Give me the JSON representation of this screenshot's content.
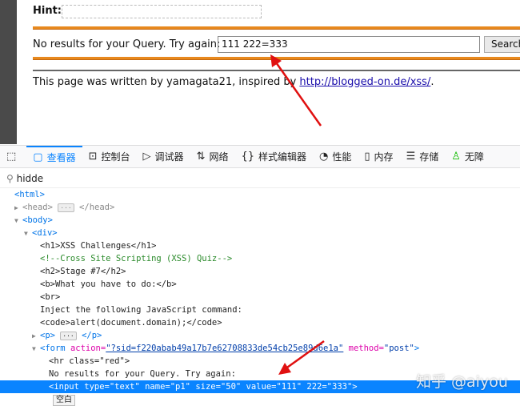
{
  "page": {
    "hint_label": "Hint:",
    "query_label": "No results for your Query. Try again:",
    "query_value": "111 222=333",
    "search_button": "Search",
    "footer_text": "This page was written by yamagata21, inspired by ",
    "footer_link": "http://blogged-on.de/xss/",
    "footer_end": "."
  },
  "devtools": {
    "tabs": [
      {
        "label": "查看器",
        "icon": "inspector-icon"
      },
      {
        "label": "控制台",
        "icon": "console-icon"
      },
      {
        "label": "调试器",
        "icon": "debugger-icon"
      },
      {
        "label": "网络",
        "icon": "network-icon"
      },
      {
        "label": "样式编辑器",
        "icon": "style-editor-icon"
      },
      {
        "label": "性能",
        "icon": "performance-icon"
      },
      {
        "label": "内存",
        "icon": "memory-icon"
      },
      {
        "label": "存储",
        "icon": "storage-icon"
      },
      {
        "label": "无障",
        "icon": "accessibility-icon"
      }
    ],
    "search_value": "hidde",
    "tree": {
      "html": "<html>",
      "head_open": "<head>",
      "head_close": "</head>",
      "body": "<body>",
      "div": "<div>",
      "h1": "<h1>XSS Challenges</h1>",
      "comment": "<!--Cross Site Scripting (XSS) Quiz-->",
      "h2": "<h2>Stage #7</h2>",
      "b": "<b>What you have to do:</b>",
      "br": "<br>",
      "inject": "Inject the following JavaScript command:",
      "code": "<code>alert(document.domain);</code>",
      "p_open": "<p>",
      "p_close": "</p>",
      "form_tag": "<form ",
      "form_action_attr": "action=",
      "form_action_val": "\"?sid=f220abab49a17b7e62708833de54cb25e89d6e1a\"",
      "form_method": " method=",
      "form_method_val": "\"post\"",
      "form_end": ">",
      "hr": "<hr class=\"red\">",
      "no_results": "No results for your Query. Try again:",
      "input": "<input type=\"text\" name=\"p1\" size=\"50\" value=\"111\" 222=\"333\">",
      "whitespace_badge": "空白"
    }
  },
  "watermark": "知乎 @aiyou",
  "colors": {
    "accent": "#0a84ff",
    "orange_rule": "#e8891d",
    "arrow": "#e01010"
  }
}
